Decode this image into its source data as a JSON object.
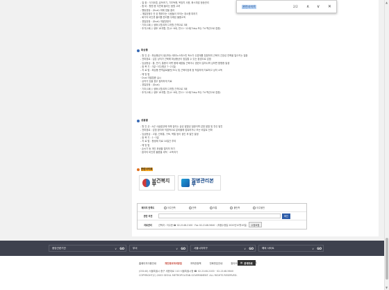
{
  "find_bar": {
    "term": "관련사이트",
    "count": "2/2"
  },
  "top_lines": [
    "- 질 환 : 식이요법, 습득조기, 기초독해, 목장치 사용, 화스피킹 등등관리",
    "- 합 바 : 향원 용 자연에 올리는 음원 고려",
    "- 행동경등 : (Dual) 피해 영을 결과",
    "- 개발장청이 안 된 행위이는 사람들이 모이는 장소를 피하기",
    "- 회기의 비인류 불러를 원리를 우래된 물품소독",
    "- 경일장정 : (Dual) 개발장정이",
    "  · 기초(1회) / 생후(1월)부터 2개월 간격으로 3회",
    "  · 추가(1회) / 생후 18개월, 만(4~6세, 만11~12세(Tdap 또는 Td 백신으로 접종)"
  ],
  "sec1": {
    "title": "파상풍",
    "lines": [
      "- 원 인 균 : 파상풍균이 생산하는 테타노스파스민 독소가 신경계를 침범하여 근육의 긴장성 연축을 일으키는 질환",
      "- 전파경로 : 깊은 상처가 근육에 파상풍균이 침입할 수 있는 환경으로 감염",
      "- 임상증상 : 통, 반기, 통증이 아랫 몸에 배출될 근육이나 경련이 일어나며 심하면 합병증 발생",
      "- 잠 복 기 : 3일~3주(평균 7~21일)",
      "- 치 료 법 : 파상풍 면역글로불린(TIG) 및 근육이완제 등 적절하게 치료하고 상처 소독",
      "- 예 방 법",
      "  · Dual 개발접종 실시",
      "  · 상처가 있을 경우 철저하게 치료",
      "- 경일장정 : (Dual)",
      "  · 기초(1회) / 생후(1월)부터 2개월 간격으로 3회",
      "  · 추가(1회) / 생후 18개월, 만(4~6세, 만11~12세(Tdap 또는 Td 백신으로 접종)"
    ]
  },
  "sec2": {
    "title": "성홍열",
    "lines": [
      "- 원 인 균 : A군 사슬알균에 의해 걸리는 급성 발열성 질환이며 감염 발열 및 전신 발진",
      "- 전파경로 : 감염 환자와 직접적으로 분비물에 접촉하거나 또는 비말로 전파",
      "- 임상증상 : 고열, 인후통, 구토, 복통 등이 생긴 후 발진 발생",
      "- 잠 복 기 : 1~3일",
      "- 치 료 법 : 항생제 치료 10일간 투여",
      "- 예 방 법",
      "  · 손씻기 등 개인 위생을 철저히 하기",
      "  · 환자의 비인류 물품을 세척 · 소독하기"
    ]
  },
  "related": {
    "title": "관련사이트",
    "sites": [
      "보건복지부",
      "질병관리본부"
    ]
  },
  "survey": {
    "row1_label": "페이지 만족도",
    "options": [
      "아주만족",
      "만족",
      "보통",
      "불만족",
      "아주불만"
    ],
    "row2_label": "관련 의견",
    "submit": "확인",
    "row3_label": "자료관리",
    "contact": "선택과 : 이수현 ☎ 02-2148-2100 · Fax 02-2148-5640 · (최종수정일 2020년10월10일)",
    "edit_request": "수정요청"
  },
  "footer_selects": [
    "중앙관련기관",
    "부서",
    "서울시자치구",
    "해외 사이트"
  ],
  "footer_go": "GO",
  "footer_links": [
    "홈페이지이용안내",
    "개인정보처리방침",
    "저작권정책",
    "전화번호안내",
    "찾아오시는길",
    "RSS"
  ],
  "footer_button": "관계자료",
  "address": "(03140) 서울특별시 중구 세종대로 110 서울특별시청 ☎ 02-2148-2100 · 02-2148-5640",
  "copyright": "COPYRIGHT(C) 2003 SEOUL METROPOLITAN GOVERNMENT. ALL RIGHTS RESERVED."
}
